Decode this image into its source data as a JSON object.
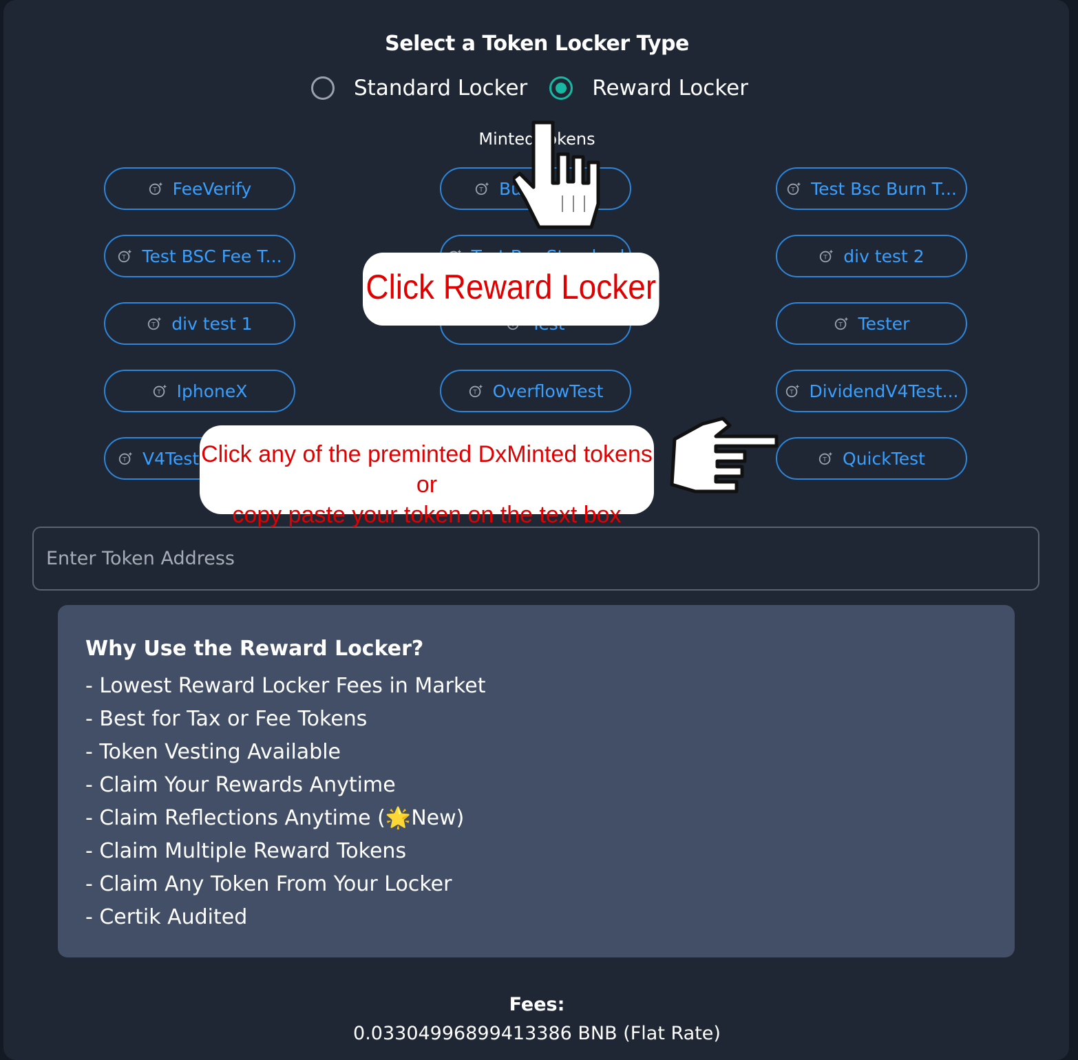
{
  "header": {
    "title": "Select a Token Locker Type"
  },
  "locker_types": [
    {
      "label": "Standard Locker",
      "selected": false
    },
    {
      "label": "Reward Locker",
      "selected": true
    }
  ],
  "minted_tokens_label": "Minted tokens",
  "tokens": [
    {
      "label": "FeeVerify"
    },
    {
      "label": "Bu"
    },
    {
      "label": "Test Bsc Burn T..."
    },
    {
      "label": "Test BSC Fee T..."
    },
    {
      "label": "Test Bsc Standard"
    },
    {
      "label": "div test 2"
    },
    {
      "label": "div test 1"
    },
    {
      "label": "Test"
    },
    {
      "label": "Tester"
    },
    {
      "label": "IphoneX"
    },
    {
      "label": "OverflowTest"
    },
    {
      "label": "DividendV4Test..."
    },
    {
      "label": "V4Teste"
    },
    {
      "label": "QuickTest"
    }
  ],
  "token_address": {
    "placeholder": "Enter Token Address",
    "value": ""
  },
  "info_box": {
    "title": "Why Use the Reward Locker?",
    "items": [
      "- Lowest Reward Locker Fees in Market",
      "- Best for Tax or Fee Tokens",
      "- Token Vesting Available",
      "- Claim Your Rewards Anytime",
      "- Claim Reflections Anytime (🌟New)",
      "- Claim Multiple Reward Tokens",
      "- Claim Any Token From Your Locker",
      "- Certik Audited"
    ]
  },
  "fees": {
    "label": "Fees:",
    "value": "0.03304996899413386 BNB (Flat Rate)"
  },
  "annotations": {
    "callout_reward": "Click Reward Locker",
    "callout_tokens_line1": "Click any of the preminted DxMinted tokens or",
    "callout_tokens_line2": "copy paste your token on the text box"
  },
  "colors": {
    "background": "#1f2735",
    "accent": "#18b9a3",
    "token_border": "#2f86d8",
    "token_text": "#3aa0ff",
    "info_box": "#424f66",
    "callout_text": "#e00000"
  },
  "icons": {
    "token": "token-icon",
    "pointer": "pointing-hand-icon"
  }
}
